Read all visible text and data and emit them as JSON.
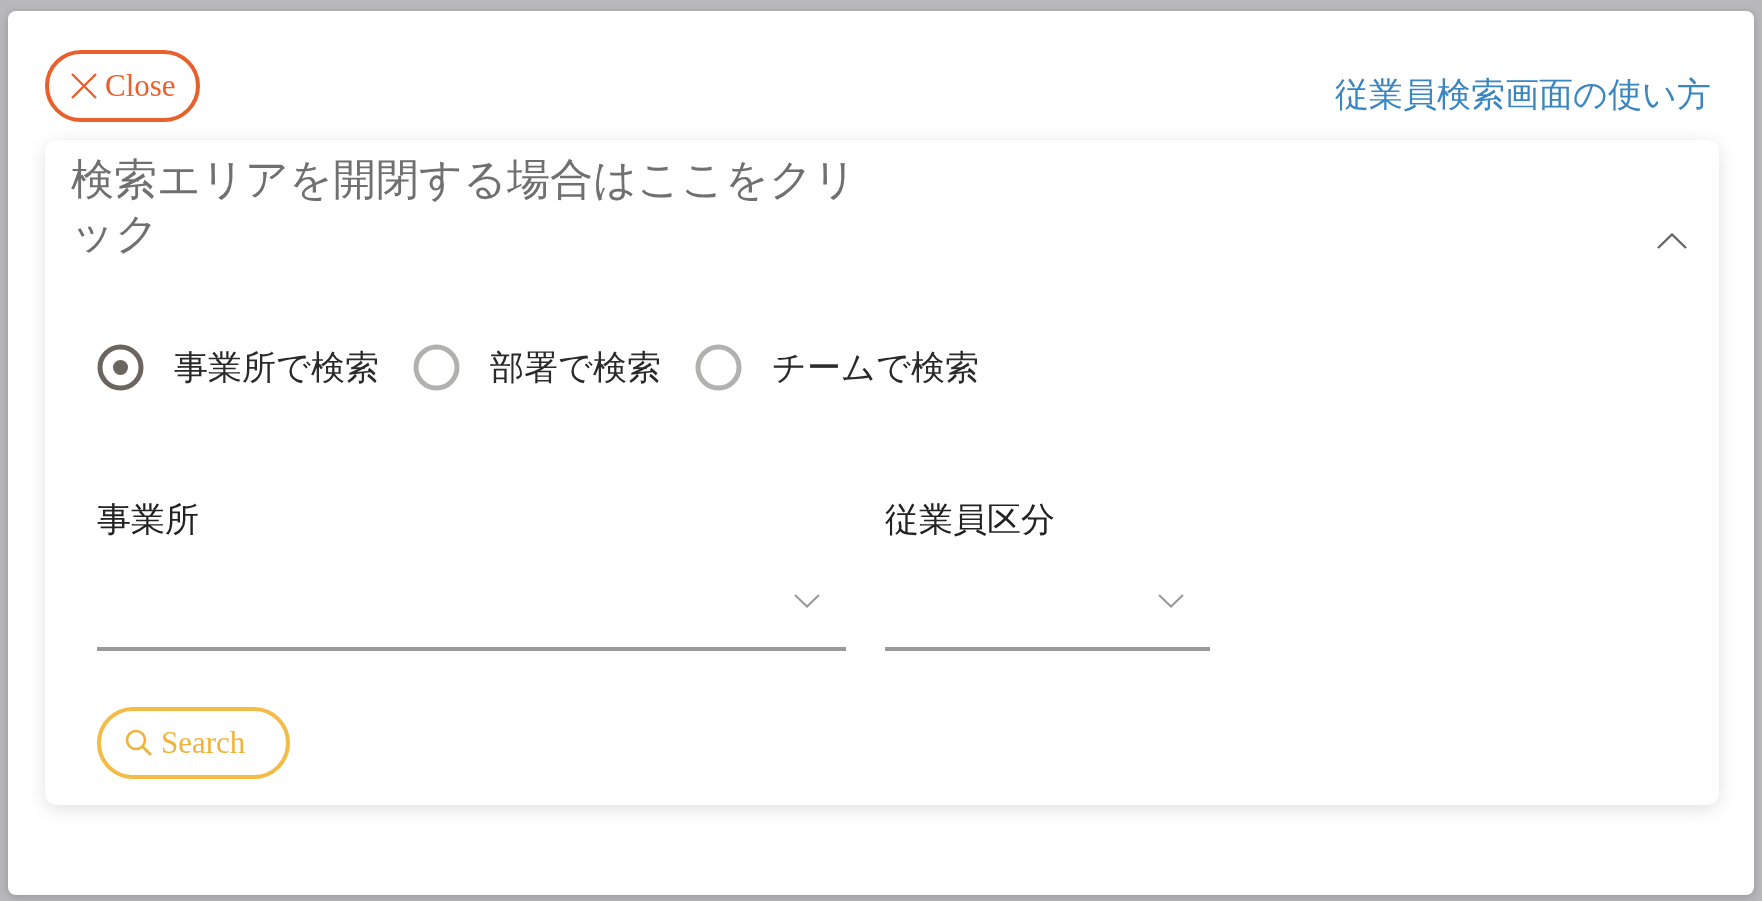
{
  "close_button": {
    "label": "Close"
  },
  "help_link": {
    "label": "従業員検索画面の使い方"
  },
  "search_panel": {
    "toggle_text": "検索エリアを開閉する場合はここをクリック",
    "expanded": true,
    "search_modes": [
      {
        "label": "事業所で検索",
        "selected": true
      },
      {
        "label": "部署で検索",
        "selected": false
      },
      {
        "label": "チームで検索",
        "selected": false
      }
    ],
    "fields": [
      {
        "label": "事業所"
      },
      {
        "label": "従業員区分"
      }
    ],
    "search_button": {
      "label": "Search"
    }
  }
}
